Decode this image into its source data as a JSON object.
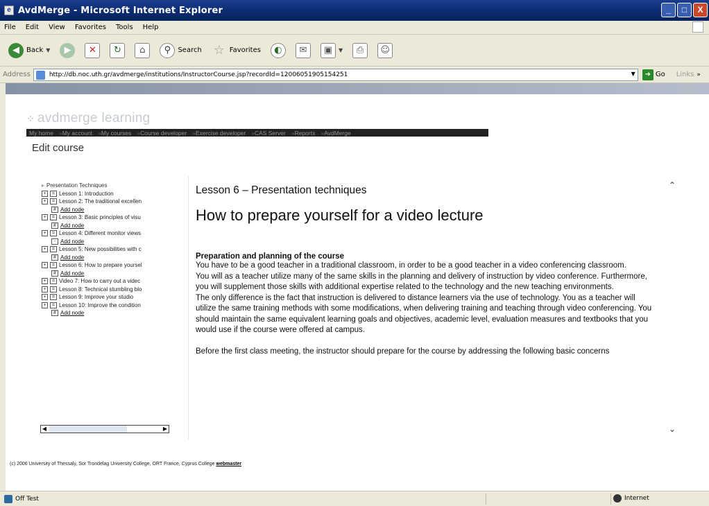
{
  "window": {
    "title": "AvdMerge - Microsoft Internet Explorer",
    "controls": [
      "_",
      "□",
      "X"
    ]
  },
  "menu": [
    "File",
    "Edit",
    "View",
    "Favorites",
    "Tools",
    "Help"
  ],
  "toolbar": {
    "back": "Back",
    "search": "Search",
    "favorites": "Favorites"
  },
  "address": {
    "label": "Address",
    "url": "http://db.noc.uth.gr/avdmerge/institutions/InstructorCourse.jsp?recordId=12006051905154251",
    "go": "Go",
    "links": "Links"
  },
  "site": {
    "logo": "avdmerge learning",
    "nav": [
      "My home",
      "My account",
      "My courses",
      "Course developer",
      "Exercise developer",
      "CAS Server",
      "Reports",
      "AvdMerge"
    ],
    "page_title": "Edit course"
  },
  "tree": {
    "root": "Presentation Techniques",
    "add_node": "Add node",
    "items": [
      {
        "label": "Lesson 1: Introduction",
        "add": false
      },
      {
        "label": "Lesson 2: The traditional excellen",
        "add": true
      },
      {
        "label": "Lesson 3: Basic principles of visu",
        "add": true
      },
      {
        "label": "Lesson 4: Different monitor views",
        "add": true
      },
      {
        "label": "Lesson 5: New possibilities with c",
        "add": true
      },
      {
        "label": "Lesson 6: How to prepare yoursel",
        "add": true
      },
      {
        "label": "Video 7: How to carry out a videc",
        "add": false
      },
      {
        "label": "Lesson 8: Technical stumbling blo",
        "add": false
      },
      {
        "label": "Lesson 9: Improve your studio",
        "add": false
      },
      {
        "label": "Lesson 10: Improve the condition",
        "add": false
      }
    ]
  },
  "content": {
    "lesson": "Lesson 6 – Presentation techniques",
    "heading": "How to prepare yourself for a video lecture",
    "subheading": "Preparation and planning of the course",
    "p1": "You have to be a good teacher in a traditional classroom, in order to be a good teacher in a video conferencing classroom.",
    "p2": "You will as a teacher utilize many of the same skills in the planning and delivery of instruction by video conference. Furthermore, you will supplement those skills with additional expertise related to the technology and the new teaching environments.",
    "p3": "The only difference is the fact that instruction is delivered to distance learners via the use of technology. You as a teacher will utilize the same training methods with some modifications, when delivering training and teaching through video conferencing. You should maintain the same equivalent learning goals and objectives, academic level, evaluation measures and textbooks that you would use if the course were offered at campus.",
    "p4": "Before the first class meeting, the instructor should prepare for the course by addressing the following basic concerns"
  },
  "footer": {
    "text": "(c) 2006 University of Thessaly, Sor Trondelag University College, ORT France, Cyprus College",
    "link": "webmaster"
  },
  "status": {
    "text": "Off Test",
    "zone": "Internet"
  }
}
